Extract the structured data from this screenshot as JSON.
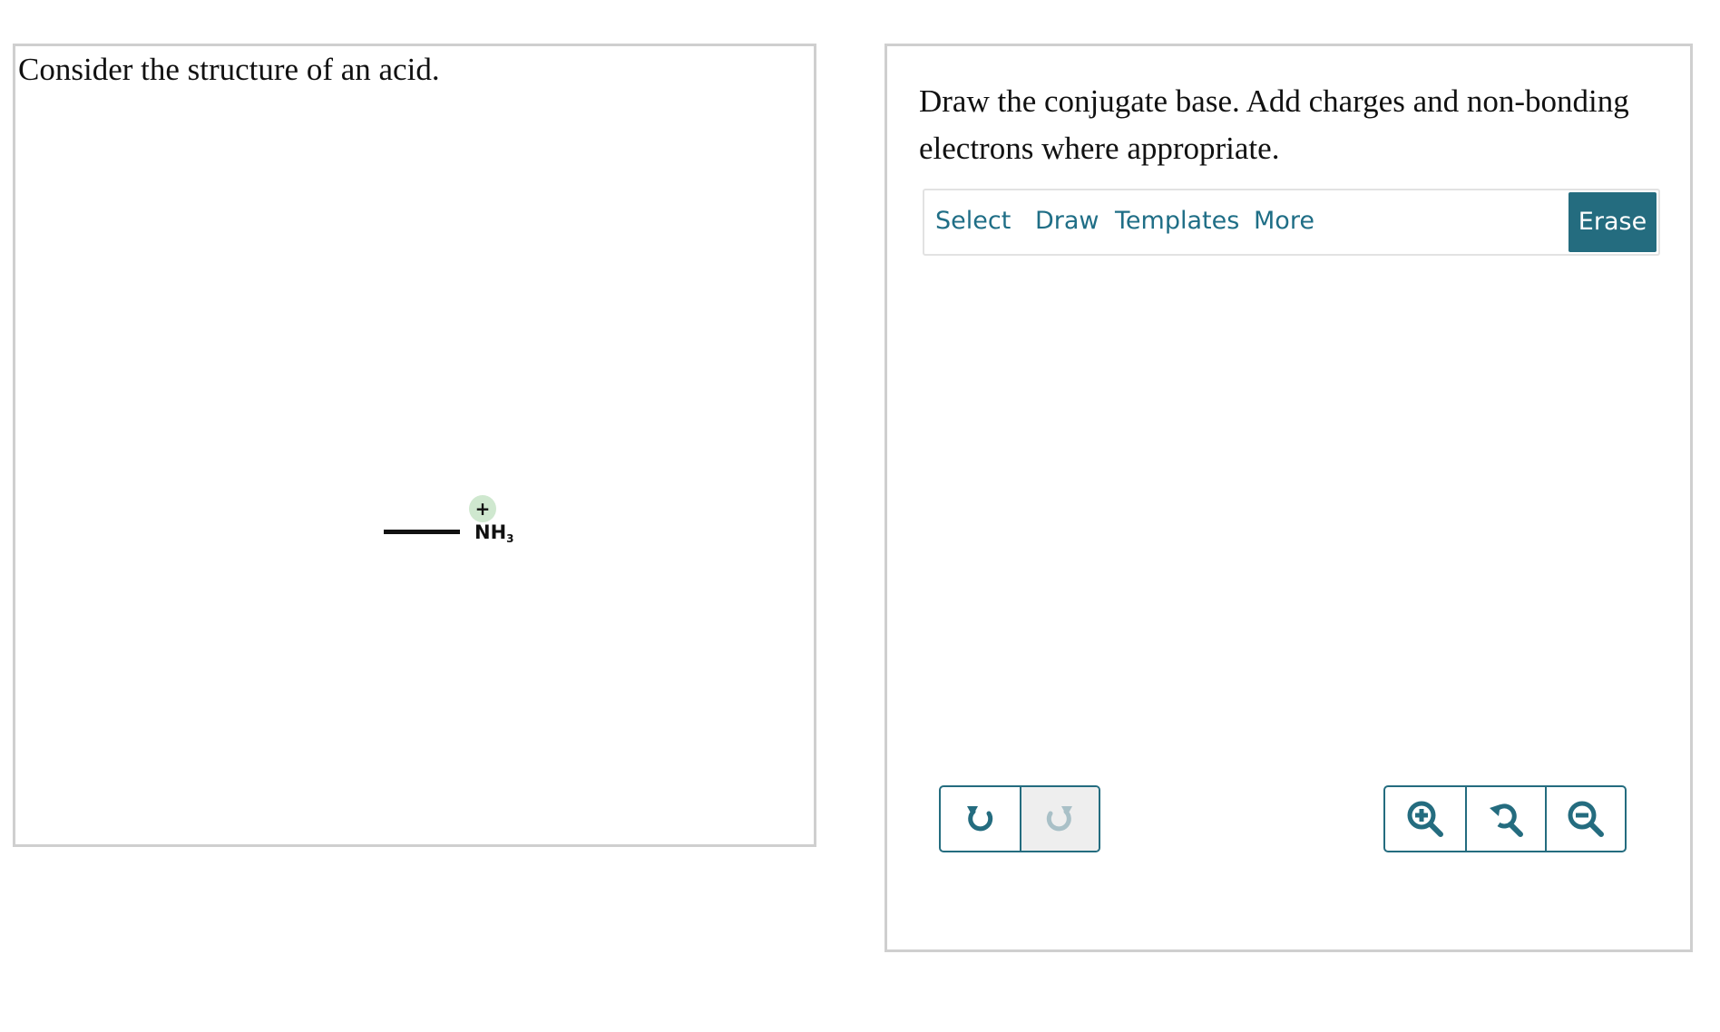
{
  "left_panel": {
    "prompt": "Consider the structure of an acid.",
    "molecule": {
      "charge_symbol": "+",
      "atom_symbol": "NH",
      "atom_subscript": "3"
    }
  },
  "right_panel": {
    "question": "Draw the conjugate base. Add charges and non-bonding electrons where appropriate.",
    "toolbar": {
      "tabs": [
        "Select",
        "Draw",
        "Templates",
        "More"
      ],
      "erase_label": "Erase"
    },
    "controls": {
      "undo_icon": "undo-icon",
      "redo_icon": "redo-icon",
      "redo_enabled": false,
      "zoom_in_icon": "zoom-in-icon",
      "zoom_reset_icon": "zoom-reset-icon",
      "zoom_out_icon": "zoom-out-icon"
    }
  },
  "colors": {
    "accent": "#246c7f",
    "tab_text": "#1f6e86",
    "charge_bg": "#cfe8cf",
    "panel_border": "#cfcfcf",
    "disabled_icon": "#a9c0c7"
  }
}
